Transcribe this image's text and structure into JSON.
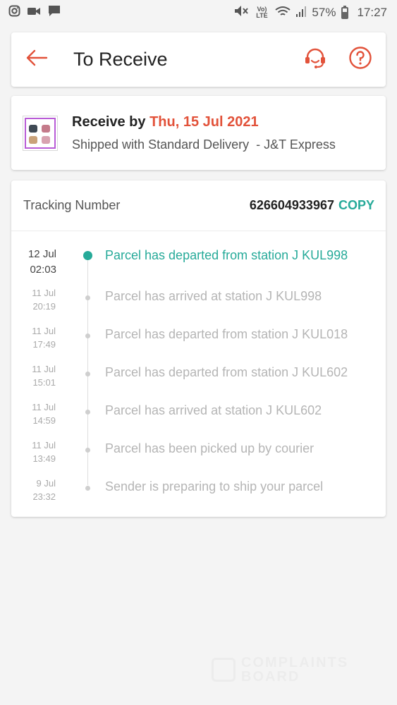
{
  "status_bar": {
    "battery": "57%",
    "time": "17:27",
    "network": "Vo) LTE",
    "icons": [
      "instagram-icon",
      "video-icon",
      "chat-icon",
      "mute-icon",
      "wifi-icon",
      "signal-icon",
      "battery-icon"
    ]
  },
  "header": {
    "title": "To Receive",
    "icons": [
      "back-arrow-icon",
      "support-headset-icon",
      "help-icon"
    ],
    "accent": "#e2523a"
  },
  "delivery": {
    "receive_prefix": "Receive by ",
    "receive_date": "Thu, 15 Jul 2021",
    "shipping": "Shipped with Standard Delivery  - J&T Express"
  },
  "tracking": {
    "label": "Tracking Number",
    "number": "626604933967",
    "copy": "COPY",
    "events": [
      {
        "date": "12 Jul",
        "time": "02:03",
        "text": "Parcel has departed from station J KUL998",
        "current": true
      },
      {
        "date": "11 Jul",
        "time": "20:19",
        "text": "Parcel has arrived at station J KUL998"
      },
      {
        "date": "11 Jul",
        "time": "17:49",
        "text": "Parcel has departed from station J KUL018"
      },
      {
        "date": "11 Jul",
        "time": "15:01",
        "text": "Parcel has departed from station J KUL602"
      },
      {
        "date": "11 Jul",
        "time": "14:59",
        "text": "Parcel has arrived at station J KUL602"
      },
      {
        "date": "11 Jul",
        "time": "13:49",
        "text": "Parcel has been picked up by courier"
      },
      {
        "date": "9 Jul",
        "time": "23:32",
        "text": "Sender is preparing to ship your parcel"
      }
    ]
  },
  "colors": {
    "accent_orange": "#e2523a",
    "teal": "#26aa99",
    "background": "#f4f4f4"
  }
}
